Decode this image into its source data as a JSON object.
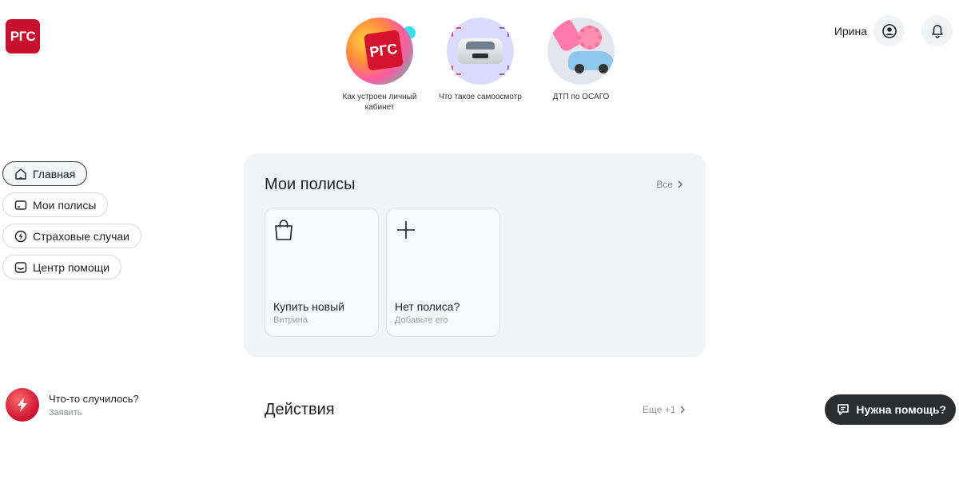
{
  "brand": {
    "logo_text": "РГС",
    "color": "#c8102e"
  },
  "stories": [
    {
      "label": "Как устроен личный кабинет",
      "badge": "РГС"
    },
    {
      "label": "Что такое самоосмотр"
    },
    {
      "label": "ДТП по ОСАГО"
    }
  ],
  "header": {
    "user_name": "Ирина",
    "profile_icon": "user-circle-icon",
    "notifications_icon": "bell-icon"
  },
  "sidebar": {
    "items": [
      {
        "label": "Главная",
        "icon": "home-icon",
        "active": true
      },
      {
        "label": "Мои полисы",
        "icon": "card-icon",
        "active": false
      },
      {
        "label": "Страховые случаи",
        "icon": "lightning-icon",
        "active": false
      },
      {
        "label": "Центр помощи",
        "icon": "inbox-icon",
        "active": false
      }
    ]
  },
  "incident": {
    "title": "Что-то случилось?",
    "subtitle": "Заявить"
  },
  "policies": {
    "title": "Мои полисы",
    "see_all": "Все",
    "cards": [
      {
        "title": "Купить новый",
        "subtitle": "Витрина",
        "icon": "shopping-bag-icon"
      },
      {
        "title": "Нет полиса?",
        "subtitle": "Добавьте его",
        "icon": "plus-icon"
      }
    ]
  },
  "actions": {
    "title": "Действия",
    "more": "Еще +1"
  },
  "help_button": {
    "label": "Нужна помощь?"
  }
}
